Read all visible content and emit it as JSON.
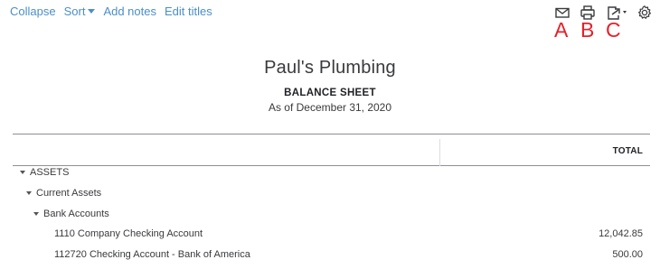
{
  "toolbar": {
    "collapse": "Collapse",
    "sort": "Sort",
    "add_notes": "Add notes",
    "edit_titles": "Edit titles",
    "link_color": "#4a8fc8"
  },
  "icons": {
    "email": "email-icon",
    "print": "print-icon",
    "export": "export-icon",
    "settings": "gear-icon"
  },
  "annotations": {
    "a": "A",
    "b": "B",
    "c": "C",
    "color": "#e5212b"
  },
  "report": {
    "company": "Paul's Plumbing",
    "name": "BALANCE SHEET",
    "date": "As of December 31, 2020",
    "total_header": "TOTAL"
  },
  "rows": [
    {
      "label": "ASSETS",
      "amount": ""
    },
    {
      "label": "Current Assets",
      "amount": ""
    },
    {
      "label": "Bank Accounts",
      "amount": ""
    },
    {
      "label": "1110 Company Checking Account",
      "amount": "12,042.85"
    },
    {
      "label": "112720 Checking Account - Bank of America",
      "amount": "500.00"
    }
  ]
}
